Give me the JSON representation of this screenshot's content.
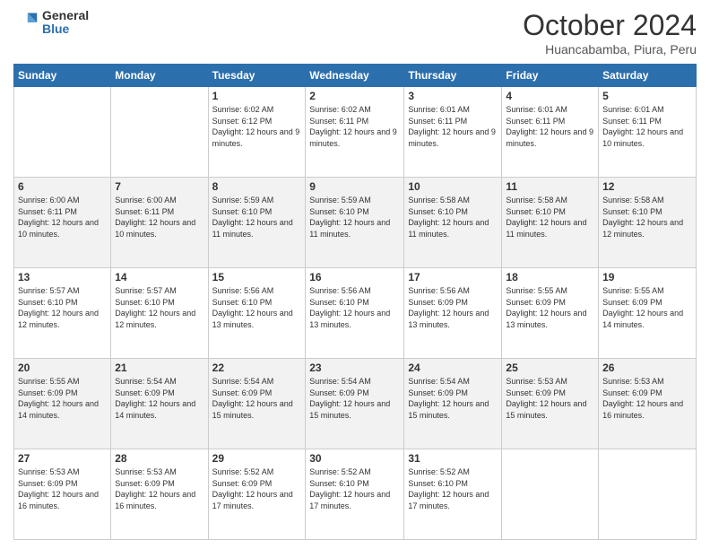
{
  "logo": {
    "general": "General",
    "blue": "Blue"
  },
  "title": {
    "month": "October 2024",
    "location": "Huancabamba, Piura, Peru"
  },
  "days_header": [
    "Sunday",
    "Monday",
    "Tuesday",
    "Wednesday",
    "Thursday",
    "Friday",
    "Saturday"
  ],
  "weeks": [
    [
      {
        "day": "",
        "info": ""
      },
      {
        "day": "",
        "info": ""
      },
      {
        "day": "1",
        "info": "Sunrise: 6:02 AM\nSunset: 6:12 PM\nDaylight: 12 hours and 9 minutes."
      },
      {
        "day": "2",
        "info": "Sunrise: 6:02 AM\nSunset: 6:11 PM\nDaylight: 12 hours and 9 minutes."
      },
      {
        "day": "3",
        "info": "Sunrise: 6:01 AM\nSunset: 6:11 PM\nDaylight: 12 hours and 9 minutes."
      },
      {
        "day": "4",
        "info": "Sunrise: 6:01 AM\nSunset: 6:11 PM\nDaylight: 12 hours and 9 minutes."
      },
      {
        "day": "5",
        "info": "Sunrise: 6:01 AM\nSunset: 6:11 PM\nDaylight: 12 hours and 10 minutes."
      }
    ],
    [
      {
        "day": "6",
        "info": "Sunrise: 6:00 AM\nSunset: 6:11 PM\nDaylight: 12 hours and 10 minutes."
      },
      {
        "day": "7",
        "info": "Sunrise: 6:00 AM\nSunset: 6:11 PM\nDaylight: 12 hours and 10 minutes."
      },
      {
        "day": "8",
        "info": "Sunrise: 5:59 AM\nSunset: 6:10 PM\nDaylight: 12 hours and 11 minutes."
      },
      {
        "day": "9",
        "info": "Sunrise: 5:59 AM\nSunset: 6:10 PM\nDaylight: 12 hours and 11 minutes."
      },
      {
        "day": "10",
        "info": "Sunrise: 5:58 AM\nSunset: 6:10 PM\nDaylight: 12 hours and 11 minutes."
      },
      {
        "day": "11",
        "info": "Sunrise: 5:58 AM\nSunset: 6:10 PM\nDaylight: 12 hours and 11 minutes."
      },
      {
        "day": "12",
        "info": "Sunrise: 5:58 AM\nSunset: 6:10 PM\nDaylight: 12 hours and 12 minutes."
      }
    ],
    [
      {
        "day": "13",
        "info": "Sunrise: 5:57 AM\nSunset: 6:10 PM\nDaylight: 12 hours and 12 minutes."
      },
      {
        "day": "14",
        "info": "Sunrise: 5:57 AM\nSunset: 6:10 PM\nDaylight: 12 hours and 12 minutes."
      },
      {
        "day": "15",
        "info": "Sunrise: 5:56 AM\nSunset: 6:10 PM\nDaylight: 12 hours and 13 minutes."
      },
      {
        "day": "16",
        "info": "Sunrise: 5:56 AM\nSunset: 6:10 PM\nDaylight: 12 hours and 13 minutes."
      },
      {
        "day": "17",
        "info": "Sunrise: 5:56 AM\nSunset: 6:09 PM\nDaylight: 12 hours and 13 minutes."
      },
      {
        "day": "18",
        "info": "Sunrise: 5:55 AM\nSunset: 6:09 PM\nDaylight: 12 hours and 13 minutes."
      },
      {
        "day": "19",
        "info": "Sunrise: 5:55 AM\nSunset: 6:09 PM\nDaylight: 12 hours and 14 minutes."
      }
    ],
    [
      {
        "day": "20",
        "info": "Sunrise: 5:55 AM\nSunset: 6:09 PM\nDaylight: 12 hours and 14 minutes."
      },
      {
        "day": "21",
        "info": "Sunrise: 5:54 AM\nSunset: 6:09 PM\nDaylight: 12 hours and 14 minutes."
      },
      {
        "day": "22",
        "info": "Sunrise: 5:54 AM\nSunset: 6:09 PM\nDaylight: 12 hours and 15 minutes."
      },
      {
        "day": "23",
        "info": "Sunrise: 5:54 AM\nSunset: 6:09 PM\nDaylight: 12 hours and 15 minutes."
      },
      {
        "day": "24",
        "info": "Sunrise: 5:54 AM\nSunset: 6:09 PM\nDaylight: 12 hours and 15 minutes."
      },
      {
        "day": "25",
        "info": "Sunrise: 5:53 AM\nSunset: 6:09 PM\nDaylight: 12 hours and 15 minutes."
      },
      {
        "day": "26",
        "info": "Sunrise: 5:53 AM\nSunset: 6:09 PM\nDaylight: 12 hours and 16 minutes."
      }
    ],
    [
      {
        "day": "27",
        "info": "Sunrise: 5:53 AM\nSunset: 6:09 PM\nDaylight: 12 hours and 16 minutes."
      },
      {
        "day": "28",
        "info": "Sunrise: 5:53 AM\nSunset: 6:09 PM\nDaylight: 12 hours and 16 minutes."
      },
      {
        "day": "29",
        "info": "Sunrise: 5:52 AM\nSunset: 6:09 PM\nDaylight: 12 hours and 17 minutes."
      },
      {
        "day": "30",
        "info": "Sunrise: 5:52 AM\nSunset: 6:10 PM\nDaylight: 12 hours and 17 minutes."
      },
      {
        "day": "31",
        "info": "Sunrise: 5:52 AM\nSunset: 6:10 PM\nDaylight: 12 hours and 17 minutes."
      },
      {
        "day": "",
        "info": ""
      },
      {
        "day": "",
        "info": ""
      }
    ]
  ]
}
